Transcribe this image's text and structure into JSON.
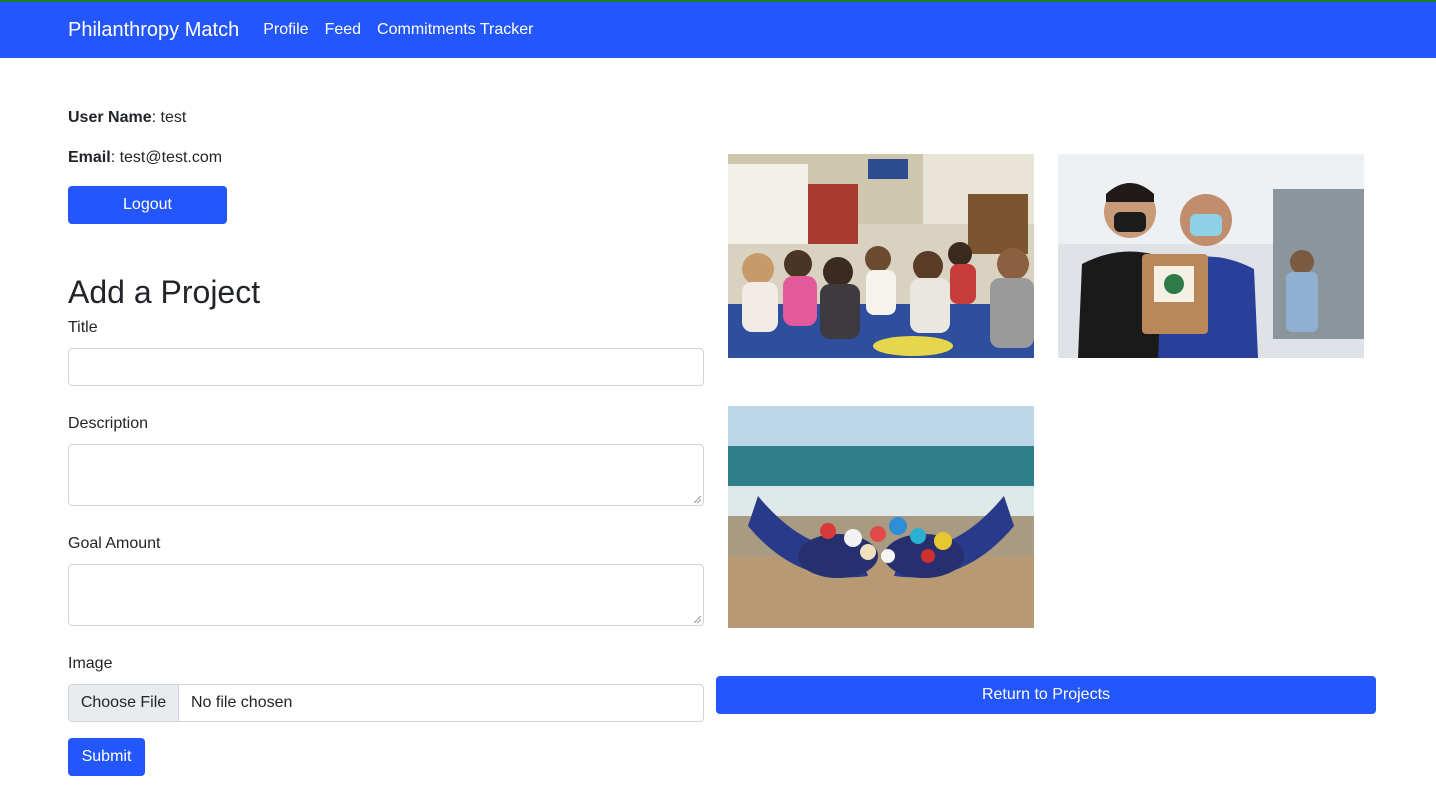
{
  "navbar": {
    "brand": "Philanthropy Match",
    "links": [
      "Profile",
      "Feed",
      "Commitments Tracker"
    ],
    "color": "#2356fb"
  },
  "profile": {
    "username_label": "User Name",
    "username_value": ": test",
    "email_label": "Email",
    "email_value": ": test@test.com",
    "logout_label": "Logout"
  },
  "form": {
    "heading": "Add a Project",
    "title_label": "Title",
    "description_label": "Description",
    "goal_label": "Goal Amount",
    "image_label": "Image",
    "choose_file_label": "Choose File",
    "file_status": "No file chosen",
    "submit_label": "Submit"
  },
  "gallery": {
    "images": [
      "classroom-photo",
      "volunteers-photo",
      "beach-cleanup-photo"
    ],
    "return_label": "Return to Projects"
  }
}
